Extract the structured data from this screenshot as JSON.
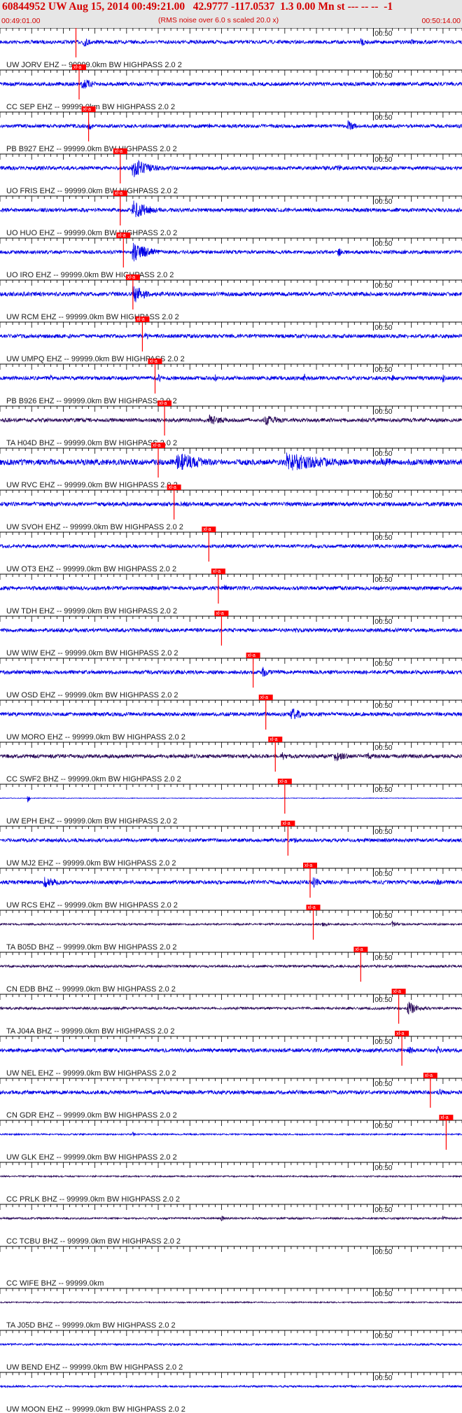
{
  "header": {
    "title": "60844952 UW Aug 15, 2014 00:49:21.00   42.9777 -117.0537  1.3 0.00 Mn st --- -- --  -1",
    "start_time": "00:49:01.00",
    "note": "(RMS noise over 6.0 s scaled 20.0 x)",
    "end_time": "00:50:14.00"
  },
  "colors": {
    "header_text": "#d40000",
    "header_bg": "#e6e6e6",
    "trace_blue": "#0000e6",
    "trace_dark": "#2a0a5a",
    "pick": "#ff0000"
  },
  "chart_data": {
    "type": "seismogram",
    "x_range": [
      "00:49:01.00",
      "00:50:14.00"
    ],
    "time_mark_label": "00:50",
    "time_mark_seconds": 59,
    "pick_label": "xl-a",
    "traces": [
      {
        "label": "UW JORV EHZ -- 99999.0km BW  HIGHPASS  2.0  2",
        "color": "blue",
        "pick_s": 12.0,
        "amp": 0.28,
        "events": [
          [
            13,
            0.9,
            1.8
          ],
          [
            57,
            0.75,
            1.5
          ],
          [
            65,
            0.5,
            2
          ]
        ]
      },
      {
        "label": "CC SEP  EHZ -- 99999.0km BW  HIGHPASS  2.0  2",
        "color": "blue",
        "pick_s": 12.5,
        "amp": 0.3,
        "events": [
          [
            13,
            1.0,
            2
          ]
        ]
      },
      {
        "label": "PB B927 EHZ -- 99999.0km BW  HIGHPASS  2.0  2",
        "color": "blue",
        "pick_s": 14.0,
        "amp": 0.28,
        "events": [
          [
            14,
            0.7,
            1
          ],
          [
            33,
            0.6,
            0.6
          ],
          [
            55,
            1.0,
            1.2
          ]
        ]
      },
      {
        "label": "UO FRIS EHZ -- 99999.0km BW  HIGHPASS  2.0  2",
        "color": "blue",
        "pick_s": 19.0,
        "amp": 0.3,
        "events": [
          [
            21,
            1.6,
            3
          ],
          [
            53.5,
            0.9,
            0.4
          ]
        ]
      },
      {
        "label": "UO HUO  EHZ -- 99999.0km BW  HIGHPASS  2.0  2",
        "color": "blue",
        "pick_s": 19.0,
        "amp": 0.3,
        "events": [
          [
            21,
            1.6,
            3
          ]
        ]
      },
      {
        "label": "UO IRO  EHZ -- 99999.0km BW  HIGHPASS  2.0  2",
        "color": "blue",
        "pick_s": 19.5,
        "amp": 0.28,
        "events": [
          [
            21,
            1.6,
            3
          ],
          [
            53.5,
            0.9,
            0.5
          ]
        ]
      },
      {
        "label": "UW RCM  EHZ -- 99999.0km BW  HIGHPASS  2.0  2",
        "color": "blue",
        "pick_s": 21.0,
        "amp": 0.32,
        "events": [
          [
            21,
            1.6,
            2.2
          ]
        ]
      },
      {
        "label": "UW UMPQ EHZ -- 99999.0km BW  HIGHPASS  2.0  2",
        "color": "blue",
        "pick_s": 22.5,
        "amp": 0.3,
        "events": [
          [
            23,
            0.7,
            1
          ]
        ]
      },
      {
        "label": "PB B926 EHZ -- 99999.0km BW  HIGHPASS  2.0  2",
        "color": "blue",
        "pick_s": 24.5,
        "amp": 0.3,
        "events": [
          [
            8,
            0.7,
            0.5
          ],
          [
            25,
            0.8,
            0.6
          ],
          [
            34,
            0.7,
            0.5
          ],
          [
            48,
            0.9,
            0.5
          ],
          [
            62,
            0.7,
            0.6
          ],
          [
            70,
            0.8,
            0.5
          ]
        ]
      },
      {
        "label": "TA H04D BHZ -- 99999.0km BW  HIGHPASS  2.0  2",
        "color": "dark",
        "pick_s": 26.0,
        "amp": 0.3,
        "events": [
          [
            33,
            0.9,
            3
          ],
          [
            42,
            0.9,
            3
          ]
        ]
      },
      {
        "label": "UW RVC  EHZ -- 99999.0km BW  HIGHPASS  2.0  2",
        "color": "blue",
        "pick_s": 25.0,
        "amp": 0.45,
        "events": [
          [
            28,
            1.6,
            5
          ],
          [
            45,
            1.6,
            8
          ],
          [
            60,
            0.8,
            5
          ]
        ]
      },
      {
        "label": "UW SVOH EHZ -- 99999.0km BW  HIGHPASS  2.0  2",
        "color": "blue",
        "pick_s": 27.5,
        "amp": 0.32,
        "events": [
          [
            29,
            0.6,
            1
          ],
          [
            56,
            0.5,
            1
          ]
        ]
      },
      {
        "label": "UW OT3  EHZ -- 99999.0km BW  HIGHPASS  2.0  2",
        "color": "blue",
        "pick_s": 33.0,
        "amp": 0.28,
        "events": []
      },
      {
        "label": "UW TDH  EHZ -- 99999.0km BW  HIGHPASS  2.0  2",
        "color": "blue",
        "pick_s": 34.5,
        "amp": 0.3,
        "events": [
          [
            35.5,
            0.6,
            1
          ]
        ]
      },
      {
        "label": "UW WIW  EHZ -- 99999.0km BW  HIGHPASS  2.0  2",
        "color": "blue",
        "pick_s": 35.0,
        "amp": 0.3,
        "events": [
          [
            36.5,
            0.5,
            1
          ]
        ]
      },
      {
        "label": "UW OSD  EHZ -- 99999.0km BW  HIGHPASS  2.0  2",
        "color": "blue",
        "pick_s": 40.0,
        "amp": 0.3,
        "events": [
          [
            41.5,
            0.9,
            1.5
          ]
        ]
      },
      {
        "label": "UW MORO EHZ -- 99999.0km BW  HIGHPASS  2.0  2",
        "color": "blue",
        "pick_s": 42.0,
        "amp": 0.3,
        "events": [
          [
            46,
            1.1,
            2
          ]
        ]
      },
      {
        "label": "CC SWF2 BHZ -- 99999.0km BW  HIGHPASS  2.0  2",
        "color": "dark",
        "pick_s": 43.5,
        "amp": 0.3,
        "events": [
          [
            44.5,
            0.7,
            2
          ],
          [
            53,
            0.9,
            2
          ],
          [
            58,
            0.6,
            2.5
          ]
        ]
      },
      {
        "label": "UW EPH  EHZ -- 99999.0km BW  HIGHPASS  2.0  2",
        "color": "blue",
        "pick_s": 45.0,
        "amp": 0.05,
        "events": [
          [
            4.5,
            1.0,
            0.15
          ]
        ]
      },
      {
        "label": "UW MJ2  EHZ -- 99999.0km BW  HIGHPASS  2.0  2",
        "color": "blue",
        "pick_s": 45.5,
        "amp": 0.28,
        "events": [
          [
            46.5,
            0.7,
            0.8
          ]
        ]
      },
      {
        "label": "UW RCS  EHZ -- 99999.0km BW  HIGHPASS  2.0  2",
        "color": "blue",
        "pick_s": 49.0,
        "amp": 0.3,
        "events": [
          [
            7,
            0.9,
            3
          ],
          [
            49.5,
            1.1,
            1
          ],
          [
            69,
            0.7,
            1
          ]
        ]
      },
      {
        "label": "TA B05D BHZ -- 99999.0km BW  HIGHPASS  2.0  2",
        "color": "dark",
        "pick_s": 49.5,
        "amp": 0.15,
        "events": [
          [
            51,
            0.4,
            1.5
          ],
          [
            62,
            0.5,
            2
          ]
        ]
      },
      {
        "label": "CN EDB  BHZ -- 99999.0km BW  HIGHPASS  2.0  2",
        "color": "dark",
        "pick_s": 57.0,
        "amp": 0.2,
        "events": []
      },
      {
        "label": "TA J04A BHZ -- 99999.0km BW  HIGHPASS  2.0  2",
        "color": "dark",
        "pick_s": 63.0,
        "amp": 0.2,
        "events": [
          [
            64.5,
            1.1,
            2
          ]
        ]
      },
      {
        "label": "UW NEL  EHZ -- 99999.0km BW  HIGHPASS  2.0  2",
        "color": "blue",
        "pick_s": 63.5,
        "amp": 0.3,
        "events": [
          [
            64.5,
            0.8,
            1
          ],
          [
            69,
            0.8,
            1
          ]
        ]
      },
      {
        "label": "CN GDR  EHZ -- 99999.0km BW  HIGHPASS  2.0  2",
        "color": "blue",
        "pick_s": 68.0,
        "amp": 0.3,
        "events": [
          [
            69.5,
            0.6,
            1
          ]
        ]
      },
      {
        "label": "UW GLK  EHZ -- 99999.0km BW  HIGHPASS  2.0  2",
        "color": "blue",
        "pick_s": 70.5,
        "amp": 0.12,
        "events": [
          [
            21,
            0.4,
            0.4
          ]
        ]
      },
      {
        "label": "CC PRLK BHZ -- 99999.0km BW  HIGHPASS  2.0  2",
        "color": "dark",
        "pick_s": null,
        "amp": 0.12,
        "events": []
      },
      {
        "label": "CC TCBU BHZ -- 99999.0km BW  HIGHPASS  2.0  2",
        "color": "dark",
        "pick_s": null,
        "amp": 0.15,
        "events": [
          [
            35,
            0.5,
            1
          ],
          [
            70,
            0.4,
            1
          ]
        ]
      },
      {
        "label": "CC WIFE BHZ -- 99999.0km",
        "color": "none",
        "pick_s": null,
        "amp": 0,
        "events": []
      },
      {
        "label": "TA J05D BHZ -- 99999.0km BW  HIGHPASS  2.0  2",
        "color": "dark",
        "pick_s": null,
        "amp": 0.1,
        "events": []
      },
      {
        "label": "UW BEND EHZ -- 99999.0km BW  HIGHPASS  2.0  2",
        "color": "blue",
        "pick_s": null,
        "amp": 0.15,
        "events": []
      },
      {
        "label": "UW MOON EHZ -- 99999.0km BW  HIGHPASS  2.0  2",
        "color": "blue",
        "pick_s": null,
        "amp": 0.15,
        "events": []
      }
    ]
  }
}
